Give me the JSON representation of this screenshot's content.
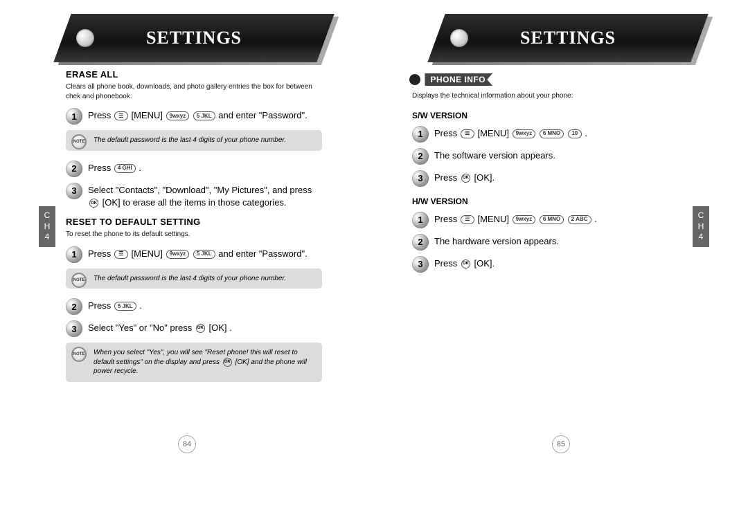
{
  "left": {
    "banner_title": "SETTINGS",
    "chtab": "C\nH\n4",
    "page_number": "84",
    "erase": {
      "head": "ERASE ALL",
      "desc": "Clears all phone book, downloads, and photo gallery entries the box for between chek and phonebook.",
      "step1_pre": "Press",
      "step1_menu": "[MENU]",
      "step1_suf": "and enter \"Password\".",
      "note1": "The default password is the last 4 digits of your phone number.",
      "step2_pre": "Press",
      "step2_suf": ".",
      "step3": "Select \"Contacts\", \"Download\", \"My Pictures\", and press",
      "step3_ok": "[OK] to erase all the items in those categories."
    },
    "reset": {
      "head": "RESET TO DEFAULT SETTING",
      "desc": "To reset the phone to its default settings.",
      "step1_pre": "Press",
      "step1_menu": "[MENU]",
      "step1_suf": "and enter \"Password\".",
      "note1": "The default password is the last 4 digits of your phone number.",
      "step2_pre": "Press",
      "step2_suf": ".",
      "step3_pre": "Select \"Yes\" or \"No\" press",
      "step3_suf": "[OK] .",
      "note2": "When you select \"Yes\", you will see \"Reset phone! this will reset to default settings\" on the display and press",
      "note2_suf": "[OK] and the phone will power recycle."
    }
  },
  "right": {
    "banner_title": "SETTINGS",
    "chtab": "C\nH\n4",
    "page_number": "85",
    "tag": "PHONE INFO",
    "tag_desc": "Displays the technical information about your phone:",
    "sw": {
      "head": "S/W VERSION",
      "step1_pre": "Press",
      "step1_menu": "[MENU]",
      "step1_suf": ".",
      "step2": "The software version appears.",
      "step3_pre": "Press",
      "step3_suf": "[OK]."
    },
    "hw": {
      "head": "H/W VERSION",
      "step1_pre": "Press",
      "step1_menu": "[MENU]",
      "step1_suf": ".",
      "step2": "The hardware version appears.",
      "step3_pre": "Press",
      "step3_suf": "[OK]."
    }
  },
  "keys": {
    "menu": "☰",
    "nine": "9wxyz",
    "five": "5 JKL",
    "four": "4 GHI",
    "one0": "10",
    "six": "6 MNO",
    "two": "2 ABC",
    "ok": "OK"
  },
  "note_label": "NOTE"
}
